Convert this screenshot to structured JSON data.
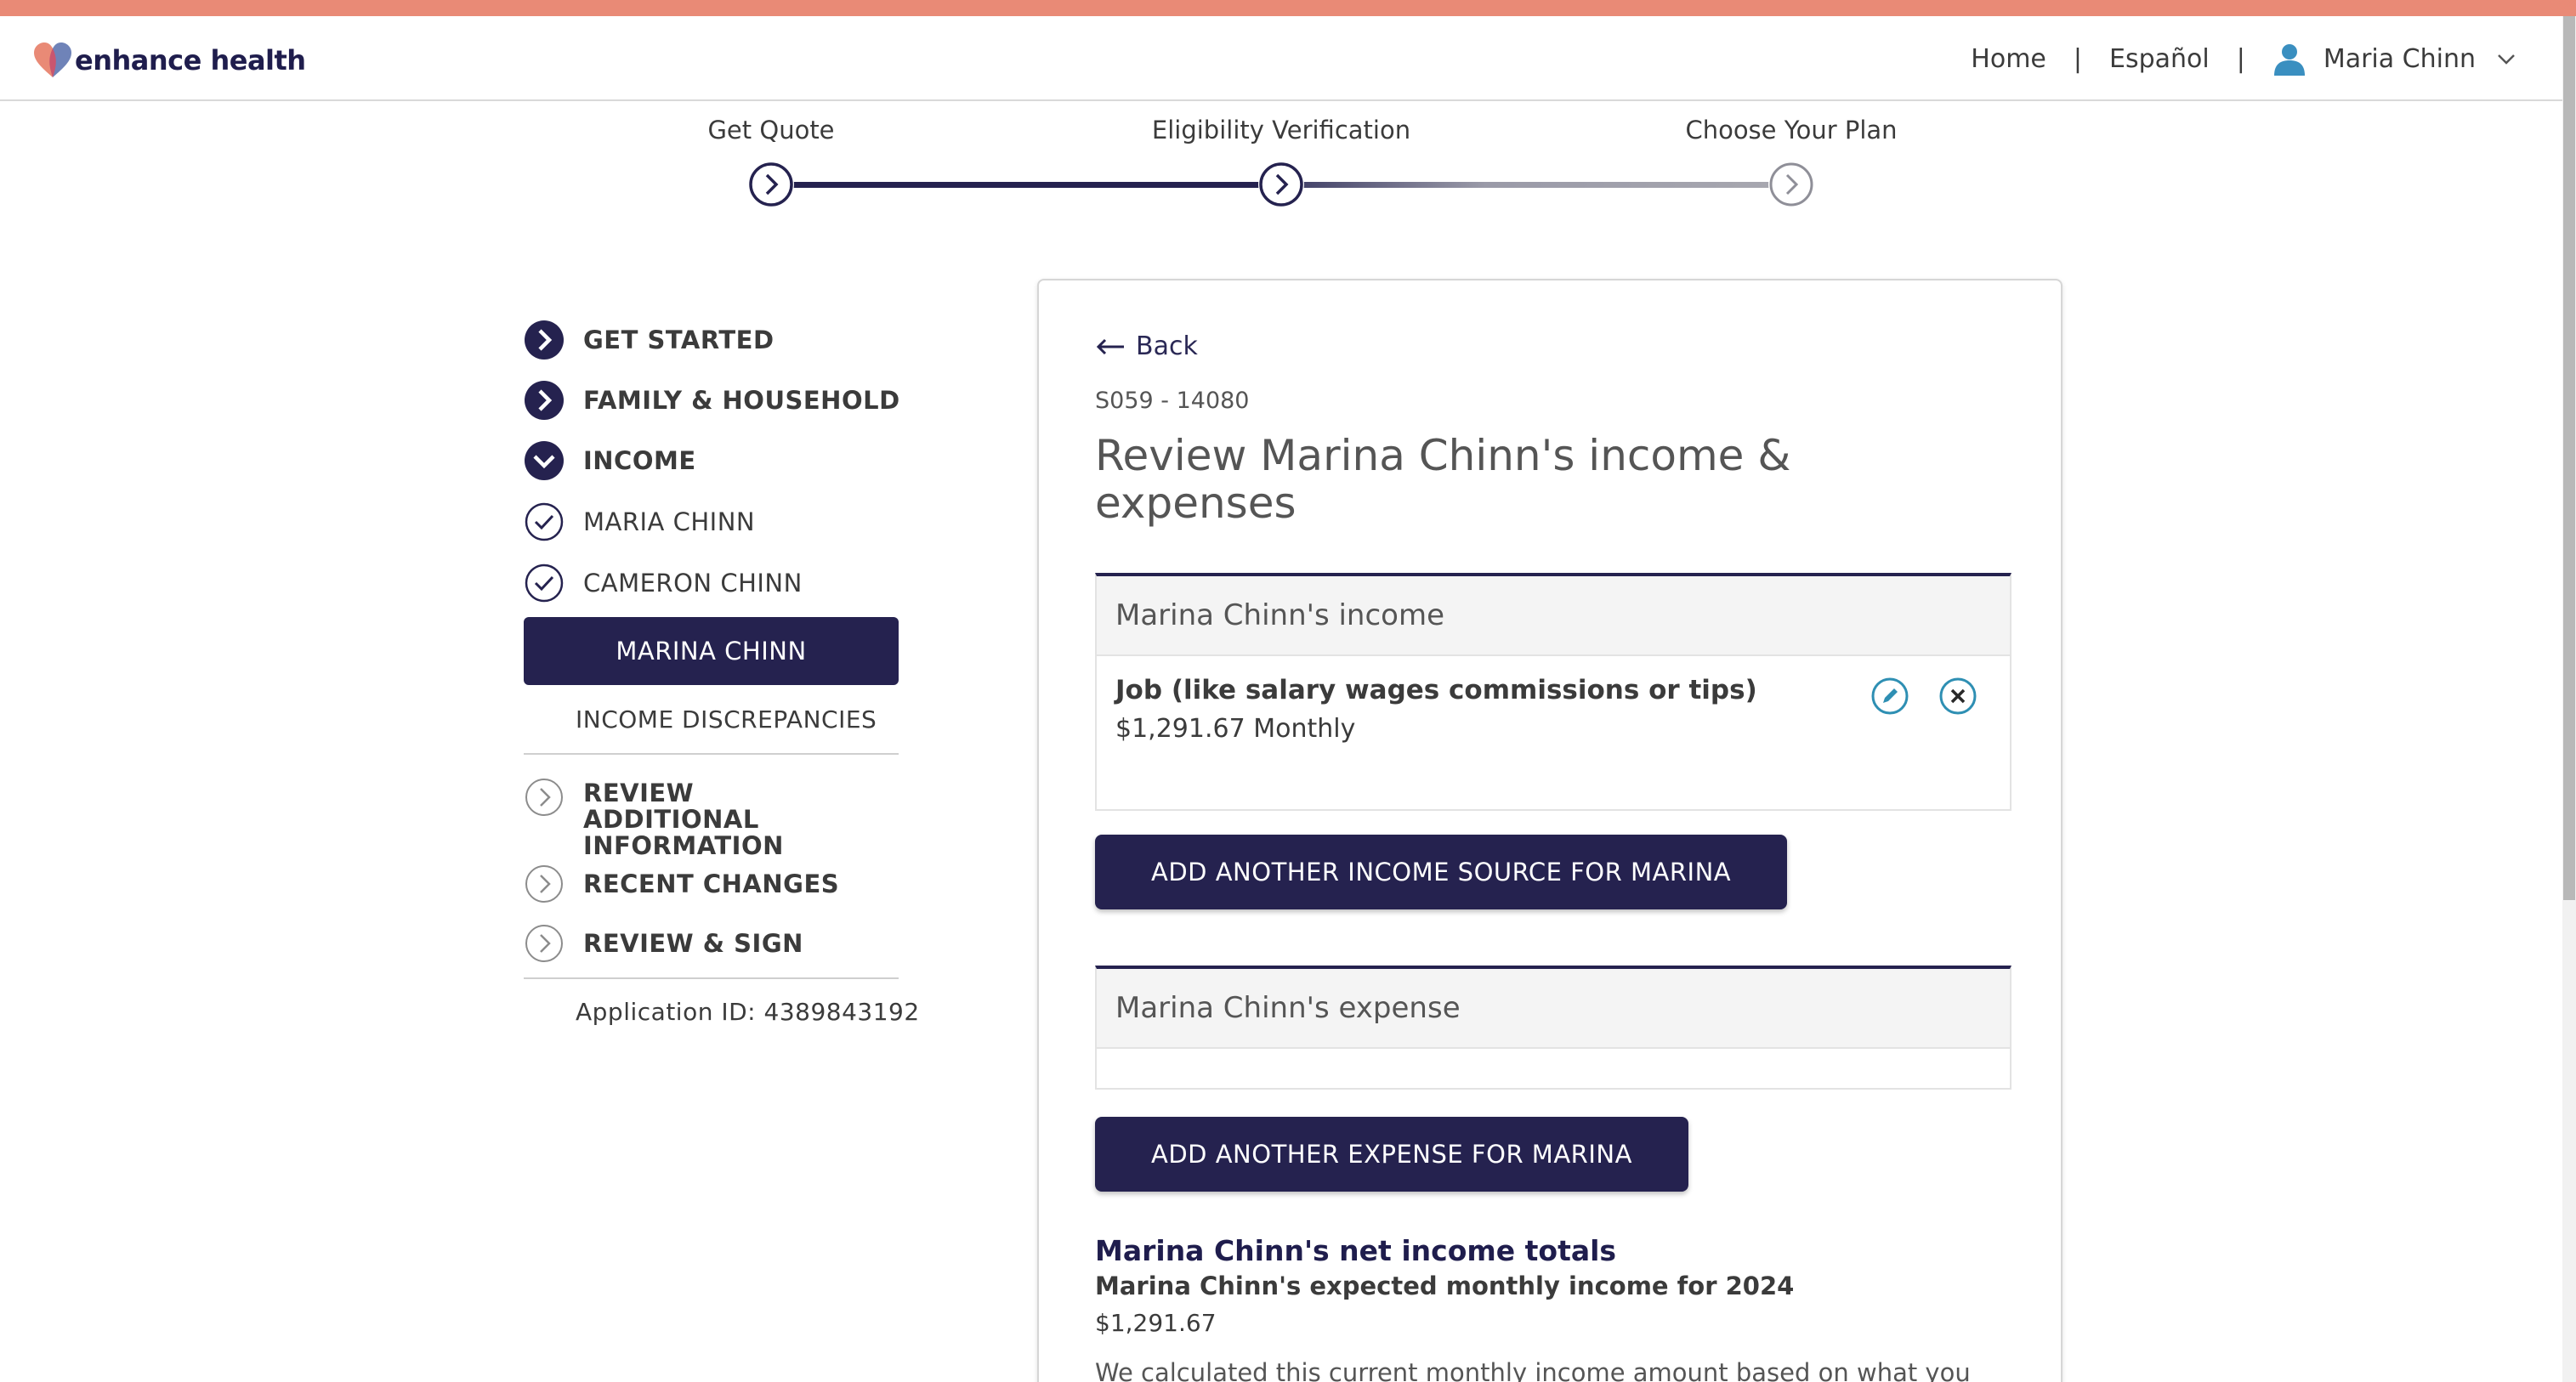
{
  "colors": {
    "top_band": "#e98a76",
    "brand_navy": "#25224f",
    "accent_teal": "#2e8fb3"
  },
  "header": {
    "logo_text": "enhance health",
    "nav": {
      "home": "Home",
      "separator": "|",
      "language": "Español",
      "user_name": "Maria Chinn"
    }
  },
  "progress": {
    "steps": [
      {
        "label": "Get Quote",
        "state": "complete"
      },
      {
        "label": "Eligibility Verification",
        "state": "current"
      },
      {
        "label": "Choose Your Plan",
        "state": "upcoming"
      }
    ]
  },
  "sidebar": {
    "items": [
      {
        "label": "GET STARTED",
        "icon": "chevron-right-filled-icon"
      },
      {
        "label": "FAMILY & HOUSEHOLD",
        "icon": "chevron-right-filled-icon"
      },
      {
        "label": "INCOME",
        "icon": "chevron-down-filled-icon"
      },
      {
        "label": "MARIA CHINN",
        "icon": "check-circle-icon"
      },
      {
        "label": "CAMERON CHINN",
        "icon": "check-circle-icon"
      },
      {
        "label": "MARINA CHINN",
        "icon": "active"
      },
      {
        "label": "INCOME DISCREPANCIES",
        "icon": "none"
      },
      {
        "label": "REVIEW ADDITIONAL INFORMATION",
        "icon": "chevron-right-outline-icon"
      },
      {
        "label": "RECENT CHANGES",
        "icon": "chevron-right-outline-icon"
      },
      {
        "label": "REVIEW & SIGN",
        "icon": "chevron-right-outline-icon"
      }
    ],
    "application_id": "Application ID: 4389843192"
  },
  "main": {
    "back_label": "Back",
    "code": "S059 - 14080",
    "title": "Review Marina Chinn's income & expenses",
    "income_panel": {
      "heading": "Marina Chinn's income",
      "entries": [
        {
          "name": "Job (like salary wages commissions or tips)",
          "amount": "$1,291.67 Monthly"
        }
      ]
    },
    "add_income_button": "ADD ANOTHER INCOME SOURCE FOR MARINA",
    "expense_panel": {
      "heading": "Marina Chinn's expense"
    },
    "add_expense_button": "ADD ANOTHER EXPENSE FOR MARINA",
    "totals": {
      "heading": "Marina Chinn's net income totals",
      "subheading": "Marina Chinn's expected monthly income for 2024",
      "amount": "$1,291.67",
      "note": "We calculated this current monthly income amount based on what you"
    }
  }
}
